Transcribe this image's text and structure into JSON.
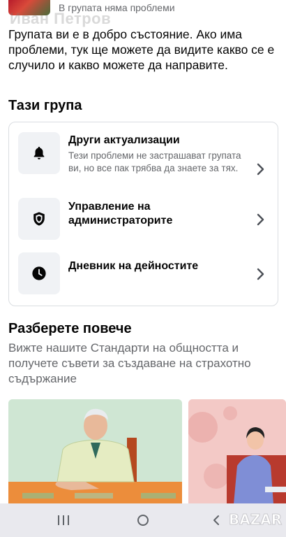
{
  "top": {
    "watermark_name": "Иван Петров",
    "status": "В групата няма проблеми"
  },
  "intro": "Групата ви е в добро състояние. Ако има проблеми, тук ще можете да видите какво се е случило и какво можете да направите.",
  "group_section": {
    "title": "Тази група",
    "items": [
      {
        "title": "Други актуализации",
        "description": "Тези проблеми не застрашават групата ви, но все пак трябва да знаете за тях.",
        "icon": "bell-icon"
      },
      {
        "title": "Управление на администраторите",
        "description": "",
        "icon": "shield-icon"
      },
      {
        "title": "Дневник на дейностите",
        "description": "",
        "icon": "clock-icon"
      }
    ]
  },
  "learn_section": {
    "title": "Разберете повече",
    "description": "Вижте нашите Стандарти на общността и получете съвети за създаване на страхотно съдържание"
  },
  "watermark_logo": "BAZAR",
  "colors": {
    "text_primary": "#050505",
    "text_secondary": "#65676b",
    "icon_bg": "#f0f2f5",
    "card_border": "#dadde1",
    "navbar_bg": "#e9e9ee"
  }
}
